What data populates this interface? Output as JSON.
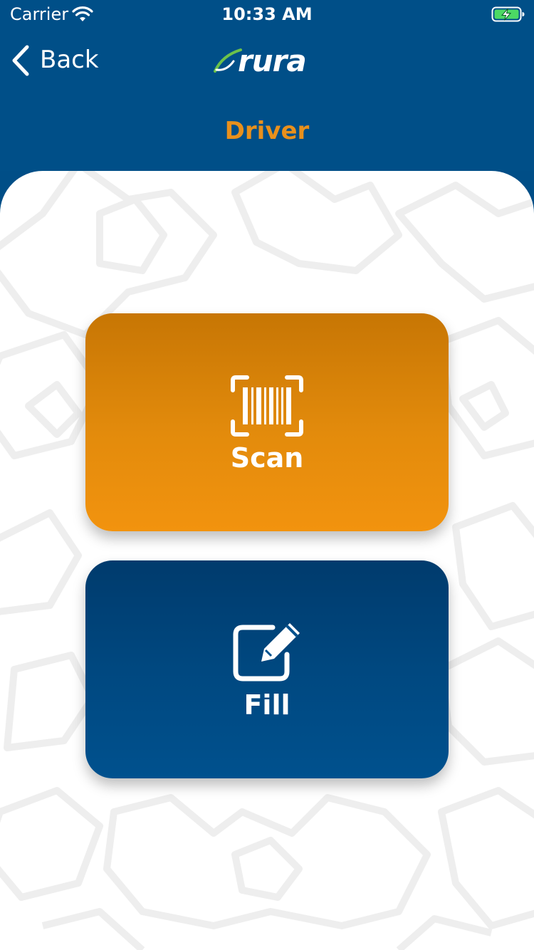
{
  "status_bar": {
    "carrier": "Carrier",
    "time": "10:33 AM",
    "icons": [
      "wifi-icon",
      "battery-charging-icon"
    ]
  },
  "nav": {
    "back_label": "Back",
    "logo_text": "rura",
    "back_icon": "chevron-left-icon"
  },
  "page": {
    "title": "Driver"
  },
  "actions": [
    {
      "label": "Scan",
      "icon": "barcode-scan-icon",
      "color": "#e38b0c"
    },
    {
      "label": "Fill",
      "icon": "edit-form-icon",
      "color": "#004880"
    }
  ],
  "colors": {
    "header_bg": "#004f88",
    "accent": "#e8901c",
    "content_bg": "#ffffff"
  }
}
